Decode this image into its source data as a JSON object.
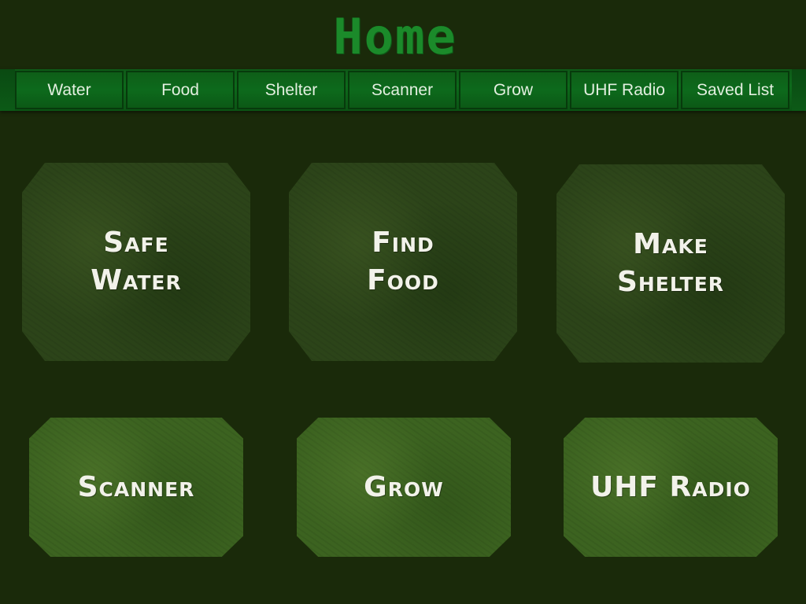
{
  "header": {
    "title": "Home"
  },
  "nav": {
    "tabs": [
      {
        "label": "Water"
      },
      {
        "label": "Food"
      },
      {
        "label": "Shelter"
      },
      {
        "label": "Scanner"
      },
      {
        "label": "Grow"
      },
      {
        "label": "UHF Radio"
      },
      {
        "label": "Saved List"
      }
    ]
  },
  "tiles": [
    {
      "label": "Safe\nWater"
    },
    {
      "label": "Find\nFood"
    },
    {
      "label": "Make\nShelter"
    },
    {
      "label": "Scanner"
    },
    {
      "label": "Grow"
    },
    {
      "label": "UHF Radio"
    }
  ],
  "colors": {
    "background": "#1a2a0a",
    "title": "#1b8a2a",
    "nav_bar": "#0d6a1b",
    "tile_dark": "#2c4419",
    "tile_light": "#3c6320",
    "tile_text": "#f2f2ea"
  }
}
